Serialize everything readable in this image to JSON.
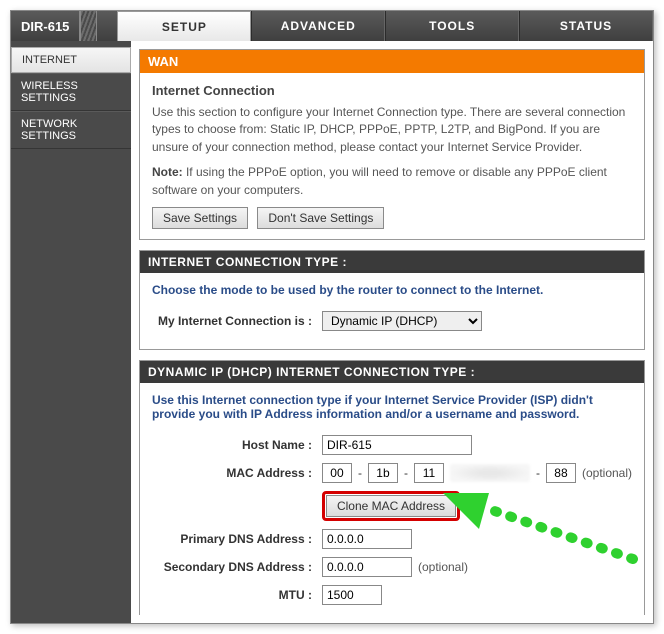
{
  "model": "DIR-615",
  "tabs": {
    "setup": "SETUP",
    "advanced": "ADVANCED",
    "tools": "TOOLS",
    "status": "STATUS"
  },
  "sidebar": {
    "internet": "INTERNET",
    "wireless": "WIRELESS SETTINGS",
    "network": "NETWORK SETTINGS"
  },
  "wan": {
    "head": "WAN",
    "subtitle": "Internet Connection",
    "desc": "Use this section to configure your Internet Connection type. There are several connection types to choose from: Static IP, DHCP, PPPoE, PPTP, L2TP, and BigPond. If you are unsure of your connection method, please contact your Internet Service Provider.",
    "note_label": "Note:",
    "note": " If using the PPPoE option, you will need to remove or disable any PPPoE client software on your computers.",
    "save": "Save Settings",
    "dont_save": "Don't Save Settings"
  },
  "conn_type": {
    "head": "INTERNET CONNECTION TYPE :",
    "instruction": "Choose the mode to be used by the router to connect to the Internet.",
    "label": "My Internet Connection is :",
    "value": "Dynamic IP (DHCP)"
  },
  "dhcp": {
    "head": "DYNAMIC IP (DHCP) INTERNET CONNECTION TYPE :",
    "instruction": "Use this Internet connection type if your Internet Service Provider (ISP) didn't provide you with IP Address information and/or a username and password.",
    "host_label": "Host Name :",
    "host_value": "DIR-615",
    "mac_label": "MAC Address :",
    "mac": [
      "00",
      "1b",
      "11",
      "",
      "",
      "88"
    ],
    "optional": "(optional)",
    "clone": "Clone MAC Address",
    "pdns_label": "Primary DNS Address :",
    "pdns_value": "0.0.0.0",
    "sdns_label": "Secondary DNS Address :",
    "sdns_value": "0.0.0.0",
    "mtu_label": "MTU :",
    "mtu_value": "1500"
  }
}
